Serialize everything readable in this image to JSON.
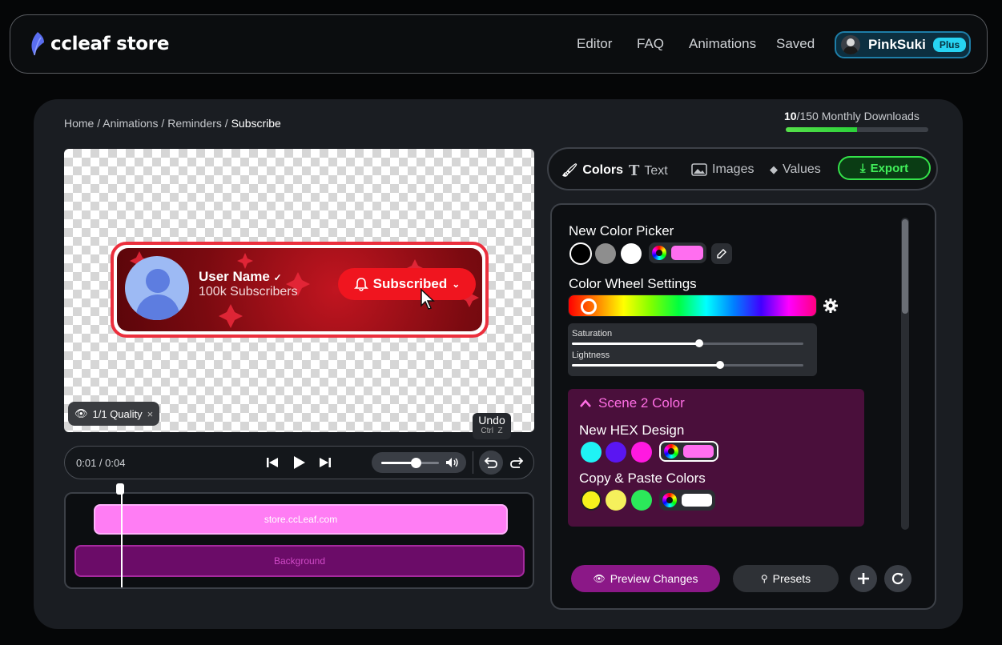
{
  "header": {
    "brand": "ccleaf store",
    "nav": [
      "Editor",
      "FAQ",
      "Animations",
      "Saved"
    ],
    "user": {
      "name": "PinkSuki",
      "badge": "Plus"
    }
  },
  "breadcrumb": {
    "items": [
      "Home",
      "Animations",
      "Reminders"
    ],
    "current": "Subscribe",
    "separator": "/"
  },
  "downloads": {
    "used": "10",
    "rest": "/150 Monthly Downloads",
    "progress": 0.5
  },
  "preview": {
    "user_name": "User Name",
    "subscribers": "100k Subscribers",
    "button_label": "Subscribed",
    "quality_label": "1/1 Quality"
  },
  "undo_tooltip": {
    "label": "Undo",
    "keys": [
      "Ctrl",
      "Z"
    ]
  },
  "player": {
    "time": "0:01 / 0:04",
    "volume": 0.6
  },
  "timeline": {
    "tracks": [
      "store.ccLeaf.com",
      "Background"
    ],
    "playhead": 0.12
  },
  "tabs": {
    "items": [
      "Colors",
      "Text",
      "Images",
      "Values"
    ],
    "active": "Colors",
    "export_label": "Export"
  },
  "panel": {
    "new_color_picker": {
      "title": "New Color Picker",
      "swatches": [
        "#000000",
        "#8e8e8e",
        "#ffffff"
      ],
      "picked": "#ff6ef0"
    },
    "color_wheel": {
      "title": "Color Wheel Settings",
      "hue_position": 0.05,
      "saturation_label": "Saturation",
      "saturation": 0.55,
      "lightness_label": "Lightness",
      "lightness": 0.64
    },
    "scene": {
      "title": "Scene 2 Color",
      "hex_title": "New HEX Design",
      "hex_swatches": [
        "#1ff3f5",
        "#5a16f2",
        "#ff19e0"
      ],
      "hex_picked": "#ff6ef0",
      "copy_title": "Copy & Paste Colors",
      "copy_swatches": [
        "#f6f21c",
        "#f5f05c",
        "#2be85a"
      ],
      "copy_picked": "#ffffff"
    },
    "preview_changes": "Preview Changes",
    "presets": "Presets"
  },
  "colors": {
    "accent_green": "#34e24a",
    "accent_pink": "#ff6ee4",
    "subscribe_red": "#f0151f"
  }
}
